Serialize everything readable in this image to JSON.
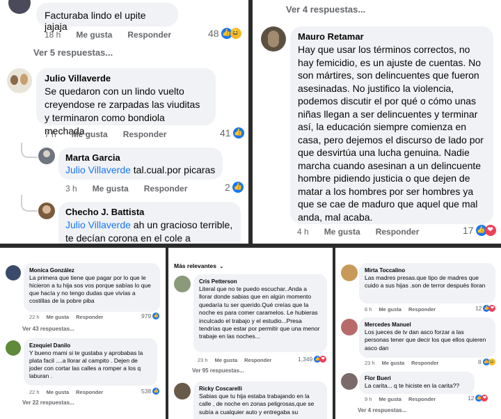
{
  "panel1": {
    "c1": {
      "text": "Facturaba lindo el upite jajaja",
      "time": "18 h",
      "like": "Me gusta",
      "reply": "Responder",
      "count": "48"
    },
    "more1": "Ver 5 respuestas...",
    "c2": {
      "name": "Julio Villaverde",
      "text": "Se quedaron con un lindo vuelto creyendose re zarpadas las viuditas y terminaron como bondiola mechada...",
      "time": "7 h",
      "like": "Me gusta",
      "reply": "Responder",
      "count": "41"
    },
    "c3": {
      "name": "Marta Garcia",
      "mention": "Julio Villaverde",
      "text": " tal.cual.por picaras",
      "time": "3 h",
      "like": "Me gusta",
      "reply": "Responder",
      "count": "2"
    },
    "c4": {
      "name": "Checho J. Battista",
      "mention": "Julio Villaverde",
      "text": " ah un gracioso terrible, te decían corona en el cole a"
    }
  },
  "panel2": {
    "more_top": "Ver 4 respuestas...",
    "c1": {
      "name": "Mauro Retamar",
      "text": "Hay que usar los términos correctos, no hay femicidio, es un ajuste de cuentas. No son mártires, son delincuentes que fueron asesinadas. No justifico la violencia, podemos discutir el por qué o cómo unas niñas llegan a ser delincuentes y terminar así, la educación siempre comienza en casa, pero dejemos el discurso de lado por que desvirtúa una lucha genuina. Nadie marcha cuando asesinan a un delincuente hombre pidiendo justicia o que dejen de matar a los hombres por ser hombres ya que se cae de maduro que aquel que mal anda, mal acaba.",
      "time": "4 h",
      "like": "Me gusta",
      "reply": "Responder",
      "count": "17"
    }
  },
  "panel3": {
    "c1": {
      "name": "Monica González",
      "text": "La primera que tiene que pagar por lo que le hicieron a tu hija sos vos porque sabías lo que que hacía y no tengo dudas que vivías a costillas de la pobre piba",
      "time": "22 h",
      "like": "Me gusta",
      "reply": "Responder",
      "count": "979"
    },
    "more1": "Ver 43 respuestas...",
    "c2": {
      "name": "Ezequiel Danilo",
      "text": "Y bueno mami si te gustaba y aprobabas la plata facil ....a llorar al campito . Dejen de joder con cortar las calles a romper a los q laburan .",
      "time": "22 h",
      "like": "Me gusta",
      "reply": "Responder",
      "count": "538"
    },
    "more2": "Ver 22 respuestas..."
  },
  "panel4": {
    "sort": "Más relevantes",
    "c1": {
      "name": "Cris Petterson",
      "text": "Literal que no te puedo escuchar..Anda a llorar donde sabias que en algún momento quedaría tu ser querido.Qué creías que la noche es para comer caramelos. Le hubieras inculcado el trabajo y el estudio...Presa tendrías que estar por permitir que una menor trabaje en las noches...",
      "time": "23 h",
      "like": "Me gusta",
      "reply": "Responder",
      "count": "1,349"
    },
    "more1": "Ver 95 respuestas...",
    "c2": {
      "name": "Ricky Coscarelli",
      "text": "Sabias que tu hija estaba trabajando en la calle , de noche en zonas peligrosas,que se subía a cualquier auto y entregaba su"
    }
  },
  "panel5": {
    "c1": {
      "name": "Mirta Toccalino",
      "text": "Las madres presas.que tipo de madres que cuido a sus hijas .son de terror después lloran",
      "time": "6 h",
      "like": "Me gusta",
      "reply": "Responder",
      "count": "12"
    },
    "c2": {
      "name": "Mercedes Manuel",
      "text": "Los jueces de tv dan asco forzar a las personas tener que decir los que ellos quieren asco dan",
      "time": "23 h",
      "like": "Me gusta",
      "reply": "Responder",
      "count": "8"
    },
    "c3": {
      "name": "Flor Bueri",
      "text": "La carita... q te hiciste en la carita??",
      "time": "9 h",
      "like": "Me gusta",
      "reply": "Responder",
      "count": "12"
    },
    "more1": "Ver 4 respuestas..."
  },
  "colors": {
    "like": "#1877f2",
    "love": "#f33e58",
    "haha": "#f7b928",
    "bubble": "#f0f2f5",
    "mention": "#1877f2"
  }
}
